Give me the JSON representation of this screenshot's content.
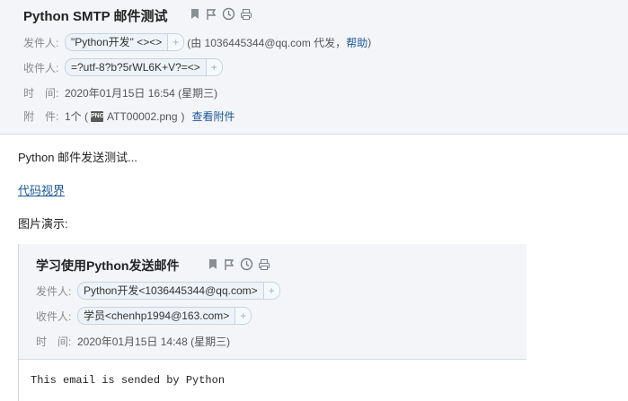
{
  "mail": {
    "subject": "Python SMTP 邮件测试",
    "from_label": "发件人:",
    "from_chip": "\"Python开发\" <><>",
    "from_via_prefix": "(由 1036445344@qq.com 代发，",
    "from_via_help": "帮助",
    "from_via_suffix": ")",
    "to_label": "收件人:",
    "to_chip": "=?utf-8?b?5rWL6K+V?=<>",
    "time_label": "时　间:",
    "time_value": "2020年01月15日 16:54 (星期三)",
    "attach_label": "附　件:",
    "attach_prefix": "1个 (",
    "attach_icon": "PNG",
    "attach_name": "ATT00002.png",
    "attach_suffix": ")",
    "attach_view": "查看附件"
  },
  "body": {
    "line1": "Python 邮件发送测试...",
    "link": "代码视界",
    "image_label": "图片演示:"
  },
  "quoted": {
    "subject": "学习使用Python发送邮件",
    "from_label": "发件人:",
    "from_chip": "Python开发<1036445344@qq.com>",
    "to_label": "收件人:",
    "to_chip": "学员<chenhp1994@163.com>",
    "time_label": "时　间:",
    "time_value": "2020年01月15日 14:48 (星期三)",
    "content": "This email is sended by Python"
  },
  "icons": [
    "bookmark-icon",
    "flag-icon",
    "clock-icon",
    "print-icon",
    "plus-icon",
    "png-file-icon"
  ]
}
